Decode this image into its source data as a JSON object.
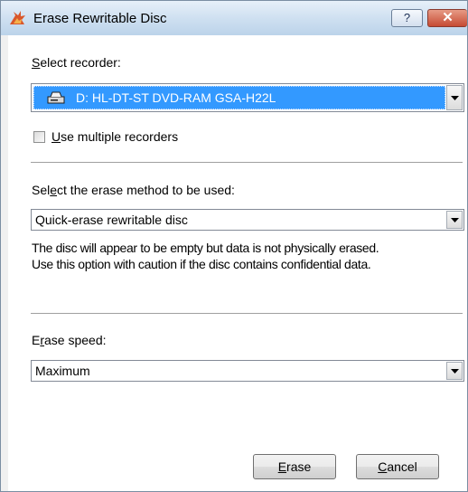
{
  "window": {
    "title": "Erase Rewritable Disc",
    "help_glyph": "?",
    "close_glyph": "✕"
  },
  "recorder": {
    "label_prefix": "S",
    "label_rest": "elect recorder:",
    "selected": "D: HL-DT-ST DVD-RAM GSA-H22L",
    "drive_icon": "optical-drive-icon"
  },
  "multiple": {
    "prefix": "U",
    "rest": "se multiple recorders",
    "checked": false
  },
  "method": {
    "label_pre": "Sel",
    "label_key": "e",
    "label_post": "ct the erase method to be used:",
    "selected": "Quick-erase rewritable disc",
    "description_line1": "The disc will appear to be empty but data is not physically erased.",
    "description_line2": "Use this option with caution if the disc contains confidential data."
  },
  "speed": {
    "label_pre": "E",
    "label_key": "r",
    "label_post": "ase speed:",
    "selected": "Maximum"
  },
  "buttons": {
    "erase_key": "E",
    "erase_rest": "rase",
    "cancel_key": "C",
    "cancel_rest": "ancel"
  }
}
